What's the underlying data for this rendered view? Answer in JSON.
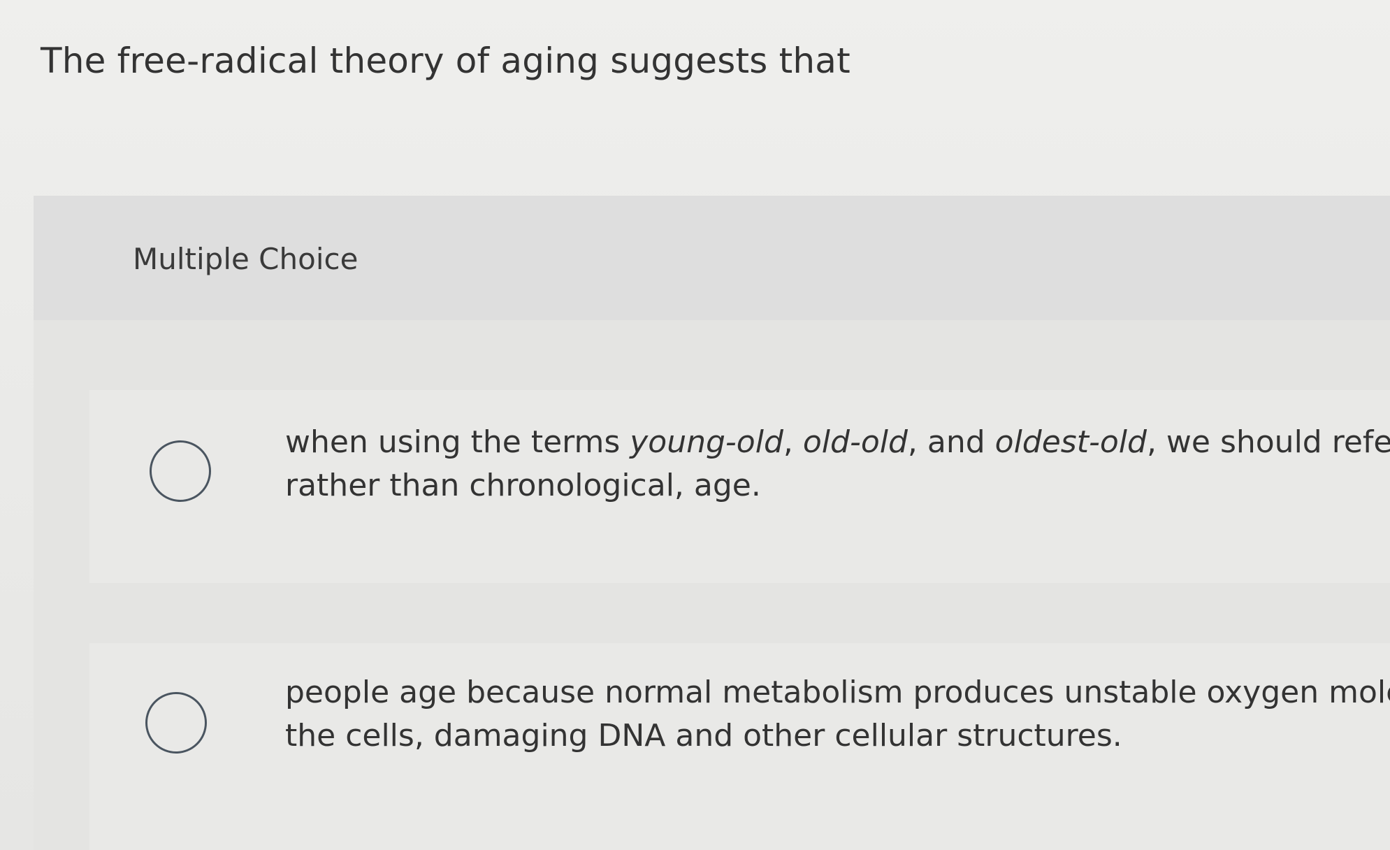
{
  "question": {
    "text": "The free-radical theory of aging suggests that"
  },
  "answer_panel": {
    "type_label": "Multiple Choice",
    "options": [
      {
        "line1_a": "when using the terms ",
        "term1": "young-old",
        "sep1": ", ",
        "term2": "old-old",
        "sep2": ", and ",
        "term3": "oldest-old",
        "line1_b": ", we should refer to a",
        "line2": "rather than chronological, age."
      },
      {
        "line1": "people age because normal metabolism produces unstable oxygen molecul",
        "line2": "the cells, damaging DNA and other cellular structures."
      }
    ]
  },
  "colors": {
    "background": "#ebebe9",
    "panel": "#e4e4e2",
    "header": "#dedede",
    "option_card": "#e9e9e7",
    "radio_border": "#4a5560",
    "text": "#333333"
  }
}
